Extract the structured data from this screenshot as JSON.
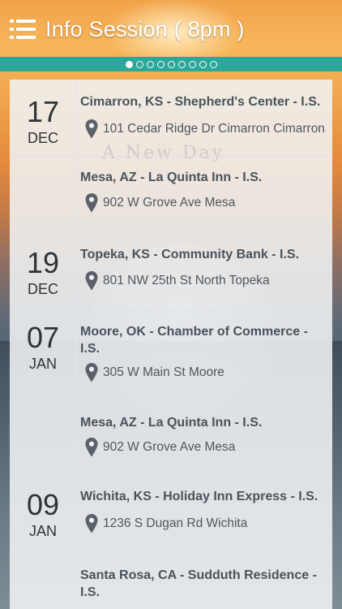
{
  "header": {
    "title": "Info Session ( 8pm )",
    "page_count": 9,
    "active_page": 0
  },
  "watermark": "A New Day",
  "colors": {
    "teal": "#2aa89a",
    "text_dark": "#2f3336",
    "text_mid": "#4a535b"
  },
  "events": [
    {
      "day": "17",
      "month": "DEC",
      "name": "Cimarron, KS - Shepherd's Center - I.S.",
      "address": "101 Cedar Ridge Dr Cimarron Cimarron"
    },
    {
      "day": "",
      "month": "",
      "name": "Mesa, AZ - La Quinta Inn - I.S.",
      "address": "902 W Grove Ave Mesa"
    },
    {
      "day": "19",
      "month": "DEC",
      "name": "Topeka, KS - Community Bank - I.S.",
      "address": "801 NW 25th St North Topeka"
    },
    {
      "day": "07",
      "month": "JAN",
      "name": "Moore, OK - Chamber of Commerce - I.S.",
      "address": "305 W Main St Moore"
    },
    {
      "day": "",
      "month": "",
      "name": "Mesa, AZ - La Quinta Inn - I.S.",
      "address": "902 W Grove Ave Mesa"
    },
    {
      "day": "09",
      "month": "JAN",
      "name": "Wichita, KS - Holiday Inn Express - I.S.",
      "address": "1236 S Dugan Rd Wichita"
    },
    {
      "day": "",
      "month": "",
      "name": "Santa Rosa, CA - Sudduth Residence - I.S.",
      "address": ""
    }
  ]
}
